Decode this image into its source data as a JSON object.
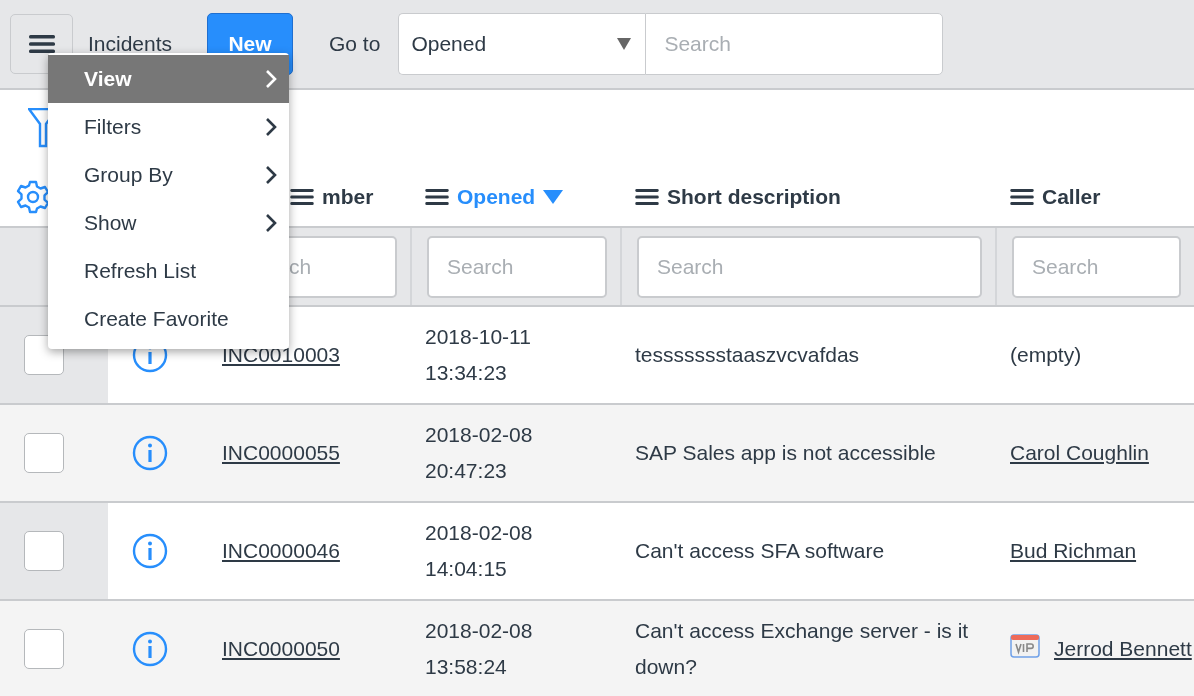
{
  "header": {
    "title": "Incidents",
    "new_button": "New",
    "goto_label": "Go to",
    "goto_select": "Opened",
    "search": {
      "placeholder": "Search"
    }
  },
  "menu": [
    {
      "label": "View",
      "submenu": true,
      "selected": true
    },
    {
      "label": "Filters",
      "submenu": true,
      "selected": false
    },
    {
      "label": "Group By",
      "submenu": true,
      "selected": false
    },
    {
      "label": "Show",
      "submenu": true,
      "selected": false
    },
    {
      "label": "Refresh List",
      "submenu": false,
      "selected": false
    },
    {
      "label": "Create Favorite",
      "submenu": false,
      "selected": false
    }
  ],
  "table": {
    "columns": [
      {
        "label": "mber",
        "sorted": false,
        "placeholder": "ch"
      },
      {
        "label": "Opened",
        "sorted": true,
        "placeholder": "Search"
      },
      {
        "label": "Short description",
        "sorted": false,
        "placeholder": "Search"
      },
      {
        "label": "Caller",
        "sorted": false,
        "placeholder": "Search"
      }
    ],
    "rows": [
      {
        "checked": false,
        "number": "INC0010003",
        "opened": [
          "2018-10-11",
          "13:34:23"
        ],
        "description": "tessssssstaaszvcvafdas",
        "caller": "(empty)",
        "caller_link": false,
        "vip": false
      },
      {
        "checked": false,
        "number": "INC0000055",
        "opened": [
          "2018-02-08",
          "20:47:23"
        ],
        "description": "SAP Sales app is not accessible",
        "caller": "Carol Coughlin",
        "caller_link": true,
        "vip": false
      },
      {
        "checked": false,
        "number": "INC0000046",
        "opened": [
          "2018-02-08",
          "14:04:15"
        ],
        "description": "Can't access SFA software",
        "caller": "Bud Richman",
        "caller_link": true,
        "vip": false
      },
      {
        "checked": false,
        "number": "INC0000050",
        "opened": [
          "2018-02-08",
          "13:58:24"
        ],
        "description": "Can't access Exchange server - is it down?",
        "caller": "Jerrod Bennett",
        "caller_link": true,
        "vip": true
      }
    ]
  }
}
